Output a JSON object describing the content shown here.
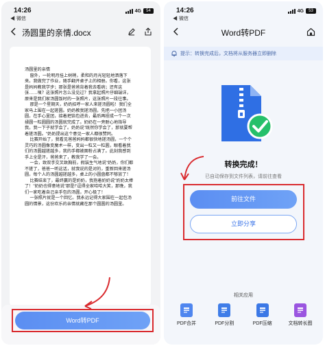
{
  "left": {
    "status": {
      "time": "14:26",
      "back_app": "◀ 微信",
      "network": "4G",
      "battery": "54"
    },
    "nav": {
      "title": "汤圆里的亲情.docx"
    },
    "document": {
      "paragraphs": [
        "汤圆里的亲情",
        "窗外，一轮明月挂上树梢，柔和的月光轻轻地洒落下来。我做完了作业，随手翻开桌子上的相册。你看，这张是妈妈教我学步；那张是爸爸背着我去看病；还有这张……咦？这张照片怎么没见过？我拿起照片仔细端详，原来是我们家汤圆饭时的一张照片，这张照片一段往事。",
        "那是一个星期天，奶奶招呼一家人来搓汤圆啦！我们全家马上围在一起搓圆。奶奶教我搓汤圆，先把一小团汤圆，在手心里团，接着把馅包进去，最后再捏成一个一次揉圆一粒圆圆的汤圆就完成了。奶奶在一旁耐心地指导我，我一下子就学会了。奶奶说\"既然你学会了，那就要帮着搓汤圆。\"奶奶提出这个意见一家人都很赞同。",
        "比赛开始了，我看见爸爸妈妈都很快地搓汤圆，一个个灵巧的汤圆像变魔术一样，变出一粒又一粒圆，眼看着我们的汤圆越搓越多，我的手都被面粉占满了。此刻我感到手上全是汗，爸爸来了，教我学了一会。",
        "一会，致双手交叉致胸前，假装生气地说\"奶奶，你们都不搓了，爸爸一听这话，就我说的是对的，重新回来搓汤圆，每个人的汤圆越搓越多，桌上的小圆盘都不够放了！",
        "比赛结束了，最终赢的是奶奶，我抱着奶奶说\"奶奶太棒了！\"奶奶也得意地说\"那是!\"逗得全家哈哈大笑，那晚，我们一家吃着自己亲手包的汤圆，开心极了！",
        "一张照片就是一个回忆。我永远记得大家围在一起包汤圆的情景，这份欢乐的亲情就藏在那个圆圆的汤圆里。"
      ]
    },
    "bottom": {
      "button_label": "Word转PDF"
    }
  },
  "right": {
    "status": {
      "time": "14:26",
      "back_app": "◀ 微信",
      "network": "4G",
      "battery": "53"
    },
    "nav": {
      "title": "Word转PDF"
    },
    "tip": {
      "text": "提示：转换完成后，文档将从服务器立即删除"
    },
    "success": {
      "title": "转换完成！",
      "subtitle": "已自动保存到文件列表，请前往查看"
    },
    "buttons": {
      "primary": "前往文件",
      "secondary": "立即分享"
    },
    "related": {
      "title": "相关应用",
      "tools": [
        {
          "label": "PDF合并",
          "icon": "pdf-merge-icon",
          "color": "#4f86ef"
        },
        {
          "label": "PDF分割",
          "icon": "pdf-split-icon",
          "color": "#3f7de8"
        },
        {
          "label": "PDF压缩",
          "icon": "pdf-compress-icon",
          "color": "#3b78e6"
        },
        {
          "label": "文档转长图",
          "icon": "doc-to-image-icon",
          "color": "#9a55e0"
        }
      ]
    }
  },
  "colors": {
    "accent": "#5b8ef2",
    "highlight": "#d9292d",
    "success": "#26c06a"
  }
}
